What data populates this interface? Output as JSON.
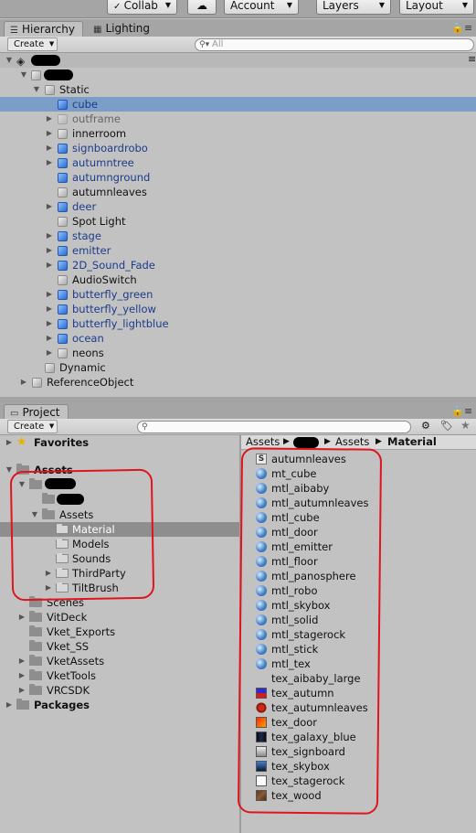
{
  "toolbar": {
    "collab_label": "Collab",
    "cloud_icon": "cloud-icon",
    "account_label": "Account",
    "layers_label": "Layers",
    "layout_label": "Layout"
  },
  "hierarchy": {
    "tab_label": "Hierarchy",
    "tab2_label": "Lighting",
    "create_label": "Create",
    "search_placeholder": "All",
    "items": [
      {
        "label": "Static"
      },
      {
        "label": "cube"
      },
      {
        "label": "outframe"
      },
      {
        "label": "innerroom"
      },
      {
        "label": "signboardrobo"
      },
      {
        "label": "autumntree"
      },
      {
        "label": "autumnground"
      },
      {
        "label": "autumnleaves"
      },
      {
        "label": "deer"
      },
      {
        "label": "Spot Light"
      },
      {
        "label": "stage"
      },
      {
        "label": "emitter"
      },
      {
        "label": "2D_Sound_Fade"
      },
      {
        "label": "AudioSwitch"
      },
      {
        "label": "butterfly_green"
      },
      {
        "label": "butterfly_yellow"
      },
      {
        "label": "butterfly_lightblue"
      },
      {
        "label": "ocean"
      },
      {
        "label": "neons"
      },
      {
        "label": "Dynamic"
      },
      {
        "label": "ReferenceObject"
      }
    ]
  },
  "project": {
    "tab_label": "Project",
    "create_label": "Create",
    "favorites_label": "Favorites",
    "assets_label": "Assets",
    "tree": [
      {
        "label": "Assets"
      },
      {
        "label": "Material"
      },
      {
        "label": "Models"
      },
      {
        "label": "Sounds"
      },
      {
        "label": "ThirdParty"
      },
      {
        "label": "TiltBrush"
      },
      {
        "label": "Scenes"
      },
      {
        "label": "VitDeck"
      },
      {
        "label": "Vket_Exports"
      },
      {
        "label": "Vket_SS"
      },
      {
        "label": "VketAssets"
      },
      {
        "label": "VketTools"
      },
      {
        "label": "VRCSDK"
      },
      {
        "label": "Packages"
      }
    ],
    "breadcrumb": {
      "root": "Assets",
      "mid": "Assets",
      "current": "Material"
    },
    "assets": [
      {
        "label": "autumnleaves",
        "icon": "script"
      },
      {
        "label": "mt_cube",
        "icon": "ball"
      },
      {
        "label": "mtl_aibaby",
        "icon": "ball"
      },
      {
        "label": "mtl_autumnleaves",
        "icon": "ball"
      },
      {
        "label": "mtl_cube",
        "icon": "ball"
      },
      {
        "label": "mtl_door",
        "icon": "ball"
      },
      {
        "label": "mtl_emitter",
        "icon": "ball"
      },
      {
        "label": "mtl_floor",
        "icon": "ball"
      },
      {
        "label": "mtl_panosphere",
        "icon": "ball"
      },
      {
        "label": "mtl_robo",
        "icon": "ball"
      },
      {
        "label": "mtl_skybox",
        "icon": "ball"
      },
      {
        "label": "mtl_solid",
        "icon": "ball"
      },
      {
        "label": "mtl_stagerock",
        "icon": "ball"
      },
      {
        "label": "mtl_stick",
        "icon": "ball"
      },
      {
        "label": "mtl_tex",
        "icon": "ball"
      },
      {
        "label": "tex_aibaby_large",
        "icon": "blank"
      },
      {
        "label": "tex_autumn",
        "icon": "tex-autumn"
      },
      {
        "label": "tex_autumnleaves",
        "icon": "tex-leaves"
      },
      {
        "label": "tex_door",
        "icon": "tex-door"
      },
      {
        "label": "tex_galaxy_blue",
        "icon": "tex-galaxy"
      },
      {
        "label": "tex_signboard",
        "icon": "tex-signboard"
      },
      {
        "label": "tex_skybox",
        "icon": "tex-skybox"
      },
      {
        "label": "tex_stagerock",
        "icon": "tex-stagerock"
      },
      {
        "label": "tex_wood",
        "icon": "tex-wood"
      }
    ]
  }
}
